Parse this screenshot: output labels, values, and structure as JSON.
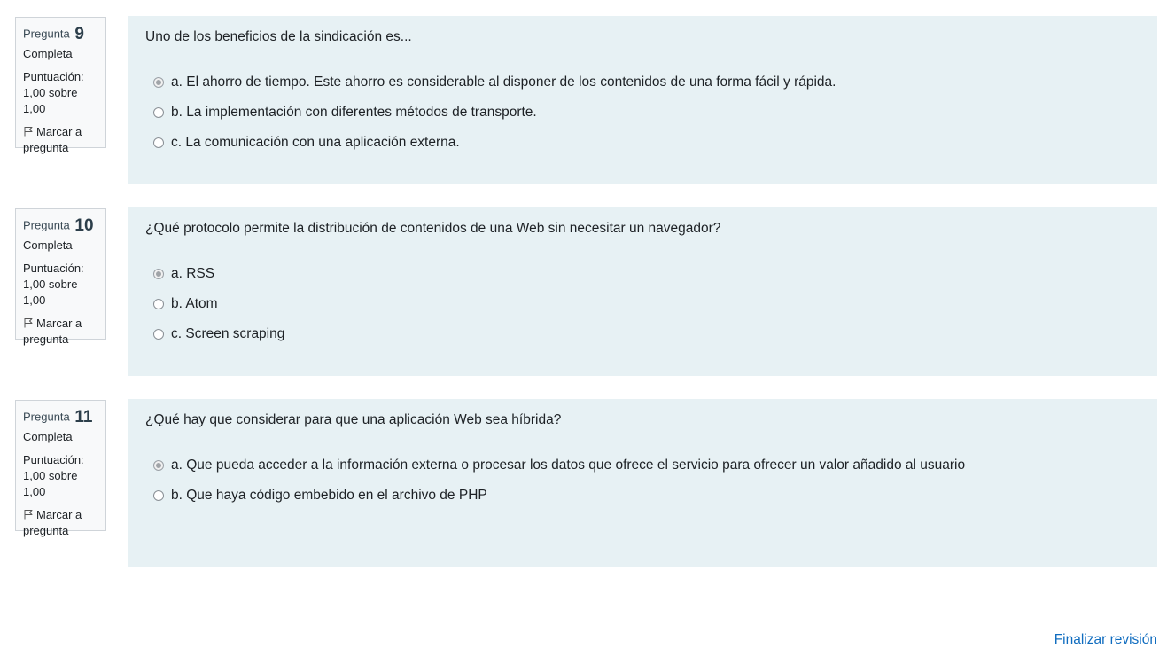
{
  "questions": [
    {
      "label": "Pregunta",
      "number": "9",
      "state": "Completa",
      "grade_label": "Puntuación:",
      "grade_value": "1,00 sobre 1,00",
      "flag_label": "Marcar a pregunta",
      "text": "Uno de los beneficios de la sindicación es...",
      "answers": [
        {
          "label": "a. El ahorro de tiempo. Este ahorro es considerable al disponer de los contenidos de una forma fácil y rápida.",
          "selected": true
        },
        {
          "label": "b. La implementación con diferentes métodos de transporte.",
          "selected": false
        },
        {
          "label": "c. La comunicación con una aplicación externa.",
          "selected": false
        }
      ]
    },
    {
      "label": "Pregunta",
      "number": "10",
      "state": "Completa",
      "grade_label": "Puntuación:",
      "grade_value": "1,00 sobre 1,00",
      "flag_label": "Marcar a pregunta",
      "text": "¿Qué protocolo permite la distribución de contenidos de una Web sin necesitar un navegador?",
      "answers": [
        {
          "label": "a. RSS",
          "selected": true
        },
        {
          "label": "b. Atom",
          "selected": false
        },
        {
          "label": "c. Screen scraping",
          "selected": false
        }
      ]
    },
    {
      "label": "Pregunta",
      "number": "11",
      "state": "Completa",
      "grade_label": "Puntuación:",
      "grade_value": "1,00 sobre 1,00",
      "flag_label": "Marcar a pregunta",
      "text": "¿Qué hay que considerar para que una aplicación Web sea híbrida?",
      "answers": [
        {
          "label": "a. Que pueda acceder a la información externa o procesar los datos que ofrece el servicio para ofrecer un valor añadido al usuario",
          "selected": true
        },
        {
          "label": "b. Que haya código embebido en el archivo de PHP",
          "selected": false
        }
      ]
    }
  ],
  "footer": {
    "finish_link": "Finalizar revisión"
  },
  "colors": {
    "content_bg": "#e7f1f4",
    "info_bg": "#f8f9fa",
    "link": "#0f6cbf"
  },
  "icons": {
    "flag": "flag-icon",
    "radio": "radio-icon"
  }
}
